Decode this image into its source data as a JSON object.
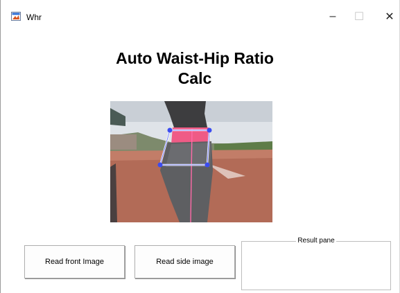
{
  "window": {
    "title": "Whr",
    "controls": [
      "minimize",
      "maximize",
      "close"
    ],
    "control_glyphs": {
      "minimize": "–",
      "maximize": "☐",
      "close": "✕"
    }
  },
  "main": {
    "heading_line1": "Auto Waist-Hip Ratio",
    "heading_line2": "Calc",
    "image_semantics": "photo-of-person-side-view-with-waist-hip-quadrilateral-overlay"
  },
  "buttons": {
    "read_front": "Read front Image",
    "read_side": "Read side image"
  },
  "result_pane": {
    "title": "Result pane",
    "content": ""
  },
  "colors": {
    "overlay_line": "#ffffff",
    "overlay_points": "#3b4cf0",
    "track": "#b56a55",
    "sky": "#e2e6ea"
  }
}
